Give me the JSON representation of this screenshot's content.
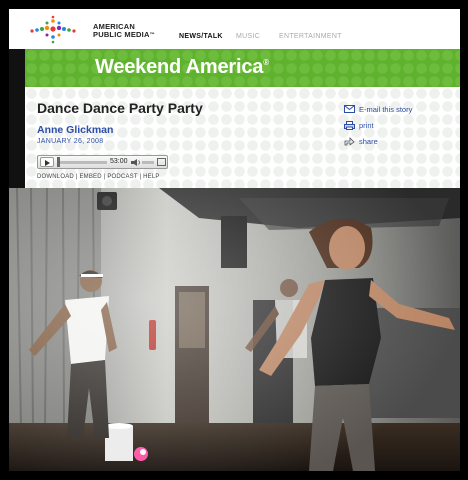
{
  "site": {
    "logo_line1": "AMERICAN",
    "logo_line2": "PUBLIC MEDIA",
    "logo_tm": "™"
  },
  "nav": [
    {
      "label": "NEWS/TALK",
      "active": true
    },
    {
      "label": "MUSIC",
      "active": false
    },
    {
      "label": "ENTERTAINMENT",
      "active": false
    }
  ],
  "banner": {
    "title": "Weekend America",
    "mark": "®"
  },
  "story": {
    "title": "Dance Dance Party Party",
    "author": "Anne Glickman",
    "date": "JANUARY 26, 2008"
  },
  "actions": [
    {
      "label": "E-mail this story",
      "icon": "envelope-icon"
    },
    {
      "label": "print",
      "icon": "printer-icon"
    },
    {
      "label": "share",
      "icon": "share-icon"
    }
  ],
  "player": {
    "time": "53:00",
    "progress": 0.0
  },
  "links": {
    "download": "DOWNLOAD",
    "embed": "EMBED",
    "podcast": "PODCAST",
    "help": "HELP",
    "sep": "|"
  },
  "colors": {
    "brand_green": "#5fb22e",
    "link_blue": "#2c4ea8"
  }
}
